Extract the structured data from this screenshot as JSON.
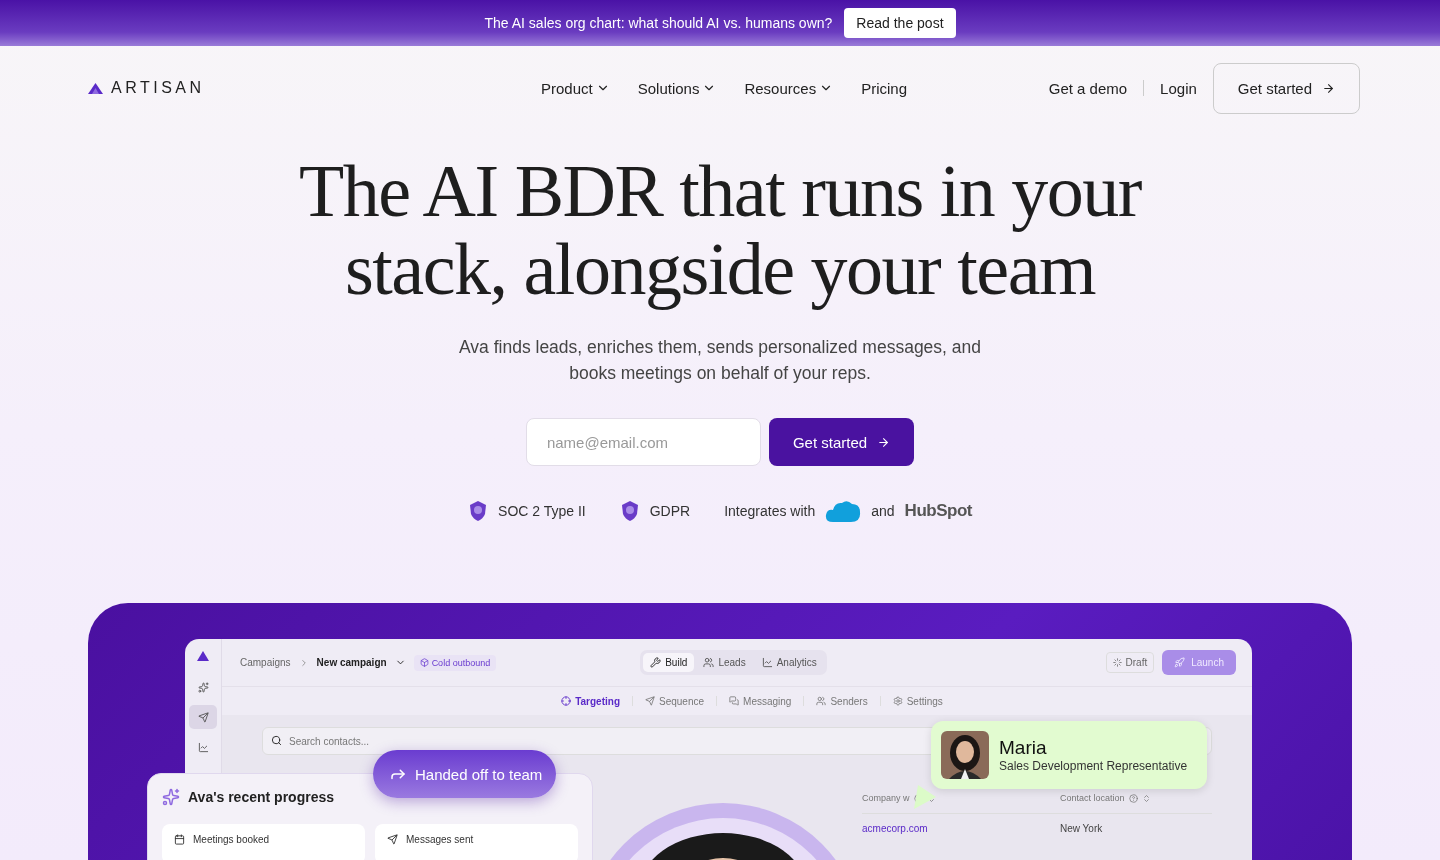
{
  "announcement": {
    "text": "The AI sales org chart: what should AI vs. humans own?",
    "button": "Read the post"
  },
  "nav": {
    "brand": "ARTISAN",
    "links": [
      {
        "label": "Product",
        "dropdown": true
      },
      {
        "label": "Solutions",
        "dropdown": true
      },
      {
        "label": "Resources",
        "dropdown": true
      },
      {
        "label": "Pricing",
        "dropdown": false
      }
    ],
    "actions": [
      "Get a demo",
      "Login"
    ],
    "cta": "Get started"
  },
  "hero": {
    "title_lines": [
      "The AI BDR that runs in your",
      "stack, alongside your team"
    ],
    "subtitle": "Ava finds leads, enriches them, sends personalized messages, and books meetings on behalf of your reps.",
    "email": {
      "placeholder": "name@email.com"
    },
    "submit": "Get started",
    "badges": [
      {
        "label": "SOC 2 Type II"
      },
      {
        "label": "GDPR"
      }
    ],
    "integrations": {
      "prefix": "Integrates with",
      "joiner": "and",
      "wordmark": "HubSpot"
    }
  },
  "app": {
    "sidebar": [
      {
        "kind": "sparkles",
        "selected": false
      },
      {
        "kind": "send",
        "selected": true
      },
      {
        "kind": "chart",
        "selected": false
      }
    ],
    "breadcrumbs": [
      "Campaigns",
      "New campaign"
    ],
    "tag": "Cold outbound",
    "views": [
      {
        "label": "Build",
        "kind": "tools",
        "selected": true
      },
      {
        "label": "Leads",
        "kind": "users",
        "selected": false
      },
      {
        "label": "Analytics",
        "kind": "chart",
        "selected": false
      }
    ],
    "status": "Draft",
    "launch": "Launch",
    "subtabs": [
      {
        "label": "Targeting",
        "kind": "target",
        "selected": true
      },
      {
        "label": "Sequence",
        "kind": "send",
        "selected": false
      },
      {
        "label": "Messaging",
        "kind": "chat",
        "selected": false
      },
      {
        "label": "Senders",
        "kind": "users",
        "selected": false
      },
      {
        "label": "Settings",
        "kind": "gear",
        "selected": false
      }
    ],
    "search": {
      "placeholder": "Search contacts..."
    },
    "columns": [
      "Company w",
      "Contact location"
    ],
    "rows": [
      [
        "acmecorp.com",
        "New York"
      ]
    ],
    "handoff": "Handed off to team",
    "profile": {
      "name": "Maria",
      "role": "Sales Development Representative"
    },
    "progress": {
      "title": "Ava's recent progress",
      "stats": [
        {
          "label": "Meetings booked",
          "kind": "calendar"
        },
        {
          "label": "Messages sent",
          "kind": "send"
        }
      ]
    }
  }
}
